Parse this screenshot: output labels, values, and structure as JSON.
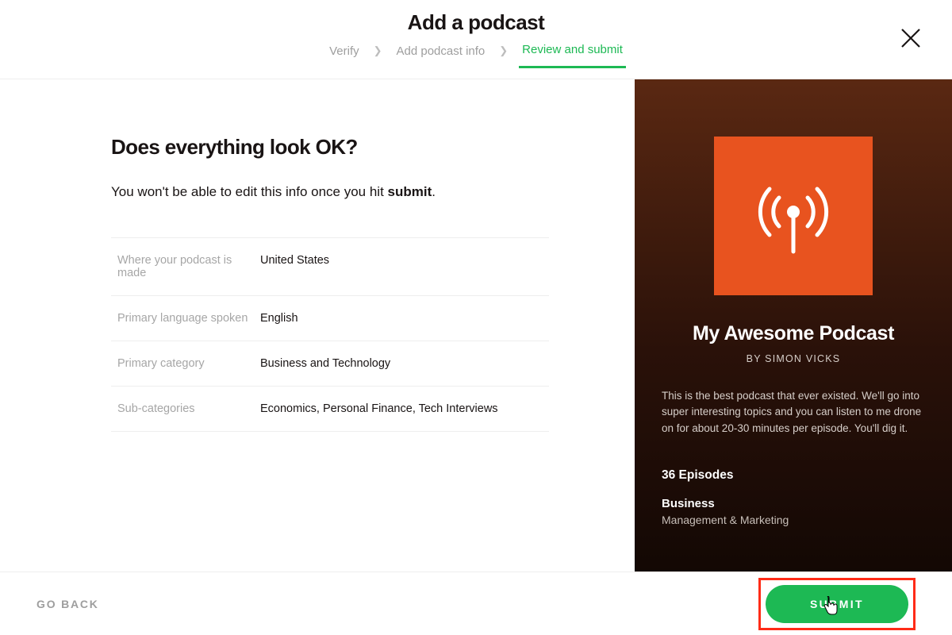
{
  "header": {
    "title": "Add a podcast",
    "breadcrumbs": [
      "Verify",
      "Add podcast info",
      "Review and submit"
    ],
    "active_index": 2
  },
  "review": {
    "heading": "Does everything look OK?",
    "note_pre": "You won't be able to edit this info once you hit ",
    "note_bold": "submit",
    "note_post": ".",
    "rows": [
      {
        "label": "Where your podcast is made",
        "value": "United States"
      },
      {
        "label": "Primary language spoken",
        "value": "English"
      },
      {
        "label": "Primary category",
        "value": "Business and Technology"
      },
      {
        "label": "Sub-categories",
        "value": "Economics, Personal Finance, Tech Interviews"
      }
    ]
  },
  "preview": {
    "title": "My Awesome Podcast",
    "byline": "BY SIMON VICKS",
    "description": "This is the best podcast that ever existed. We'll go into super interesting topics and you can listen to me drone on for about 20-30 minutes per episode. You'll dig it.",
    "episodes": "36 Episodes",
    "category_primary": "Business",
    "category_sub": "Management & Marketing"
  },
  "footer": {
    "back": "GO BACK",
    "submit": "SUBMIT"
  }
}
